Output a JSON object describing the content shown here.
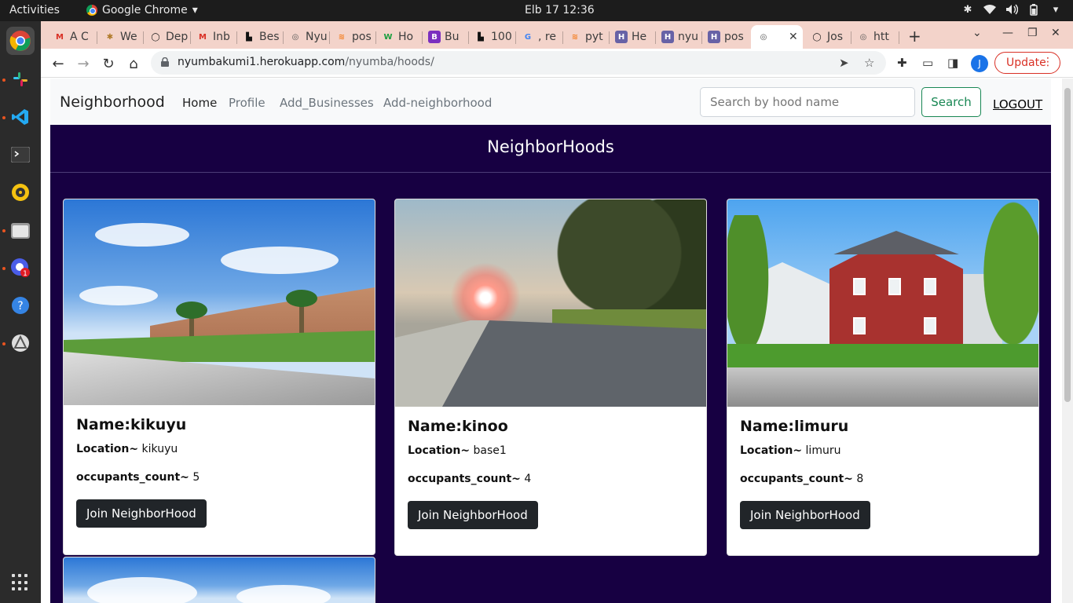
{
  "os": {
    "activities": "Activities",
    "app_name": "Google Chrome",
    "clock": "Elb 17  12:36"
  },
  "browser": {
    "tabs": [
      {
        "label": "A C",
        "fav": "M"
      },
      {
        "label": "We",
        "fav": "✱"
      },
      {
        "label": "Dep",
        "fav": "◯"
      },
      {
        "label": "Inb",
        "fav": "M"
      },
      {
        "label": "Bes",
        "fav": "▙"
      },
      {
        "label": "Nyu",
        "fav": "◎"
      },
      {
        "label": "pos",
        "fav": "≋"
      },
      {
        "label": "Ho",
        "fav": "W"
      },
      {
        "label": "Bu",
        "fav": "B"
      },
      {
        "label": "100",
        "fav": "▙"
      },
      {
        "label": ", re",
        "fav": "G"
      },
      {
        "label": "pyt",
        "fav": "≋"
      },
      {
        "label": "He",
        "fav": "H"
      },
      {
        "label": "nyu",
        "fav": "H"
      },
      {
        "label": "pos",
        "fav": "H"
      },
      {
        "label": "",
        "fav": "◎"
      },
      {
        "label": "Jos",
        "fav": "◯"
      },
      {
        "label": "htt",
        "fav": "◎"
      }
    ],
    "url_host": "nyumbakumi1.herokuapp.com",
    "url_path": "/nyumba/hoods/",
    "avatar_letter": "J",
    "update_label": "Update"
  },
  "site": {
    "brand": "Neighborhood",
    "nav": [
      {
        "label": "Home"
      },
      {
        "label": "Profile"
      },
      {
        "label": "Add_Businesses"
      },
      {
        "label": "Add-neighborhood"
      }
    ],
    "search": {
      "placeholder": "Search by hood name",
      "button": "Search"
    },
    "logout": "LOGOUT",
    "heading": "NeighborHoods"
  },
  "hoods": [
    {
      "name": "Name:kikuyu",
      "location_label": "Location~",
      "location": "kikuyu",
      "count_label": "occupants_count~",
      "count": "5",
      "button": "Join NeighborHood"
    },
    {
      "name": "Name:kinoo",
      "location_label": "Location~",
      "location": "base1",
      "count_label": "occupants_count~",
      "count": "4",
      "button": "Join NeighborHood"
    },
    {
      "name": "Name:limuru",
      "location_label": "Location~",
      "location": "limuru",
      "count_label": "occupants_count~",
      "count": "8",
      "button": "Join NeighborHood"
    }
  ],
  "colors": {
    "hero_bg": "#170042",
    "search_green": "#198754",
    "button_dark": "#212529",
    "tabstrip": "#f3d3ca"
  }
}
